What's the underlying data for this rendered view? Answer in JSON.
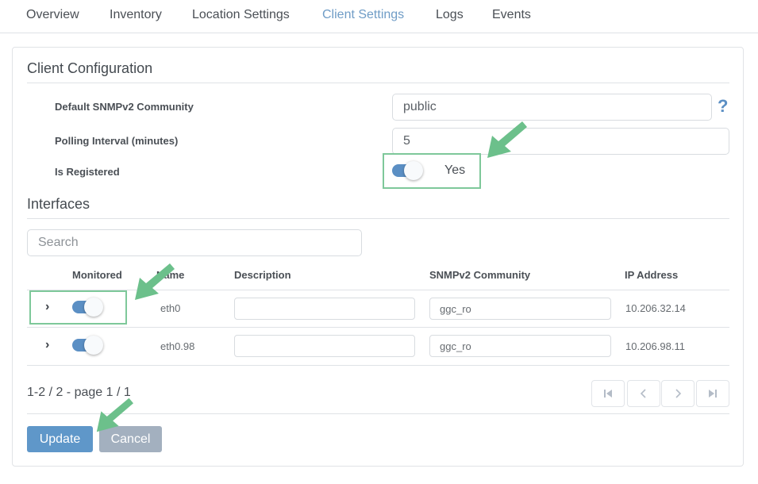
{
  "tabs": [
    {
      "label": "Overview",
      "active": false
    },
    {
      "label": "Inventory",
      "active": false
    },
    {
      "label": "Location Settings",
      "active": false
    },
    {
      "label": "Client Settings",
      "active": true
    },
    {
      "label": "Logs",
      "active": false
    },
    {
      "label": "Events",
      "active": false
    }
  ],
  "client_config": {
    "title": "Client Configuration",
    "fields": {
      "community_label": "Default SNMPv2 Community",
      "community_value": "public",
      "polling_label": "Polling Interval (minutes)",
      "polling_value": "5",
      "registered_label": "Is Registered",
      "registered_on": true,
      "registered_text": "Yes"
    },
    "help_icon": "?"
  },
  "interfaces": {
    "title": "Interfaces",
    "search_placeholder": "Search",
    "columns": {
      "monitored": "Monitored",
      "name": "Name",
      "description": "Description",
      "community": "SNMPv2 Community",
      "ip": "IP Address"
    },
    "rows": [
      {
        "monitored": true,
        "name": "eth0",
        "description": "",
        "community": "ggc_ro",
        "ip": "10.206.32.14"
      },
      {
        "monitored": true,
        "name": "eth0.98",
        "description": "",
        "community": "ggc_ro",
        "ip": "10.206.98.11"
      }
    ],
    "pager": {
      "info": "1-2 / 2 - page 1 / 1",
      "first": "first-page-icon",
      "prev": "prev-page-icon",
      "next": "next-page-icon",
      "last": "last-page-icon"
    }
  },
  "actions": {
    "update_label": "Update",
    "cancel_label": "Cancel"
  },
  "colors": {
    "accent": "#5b8fc4",
    "active_tab": "#6f9cc6",
    "annotation": "#6cc08b",
    "cancel": "#a3b0bf"
  }
}
